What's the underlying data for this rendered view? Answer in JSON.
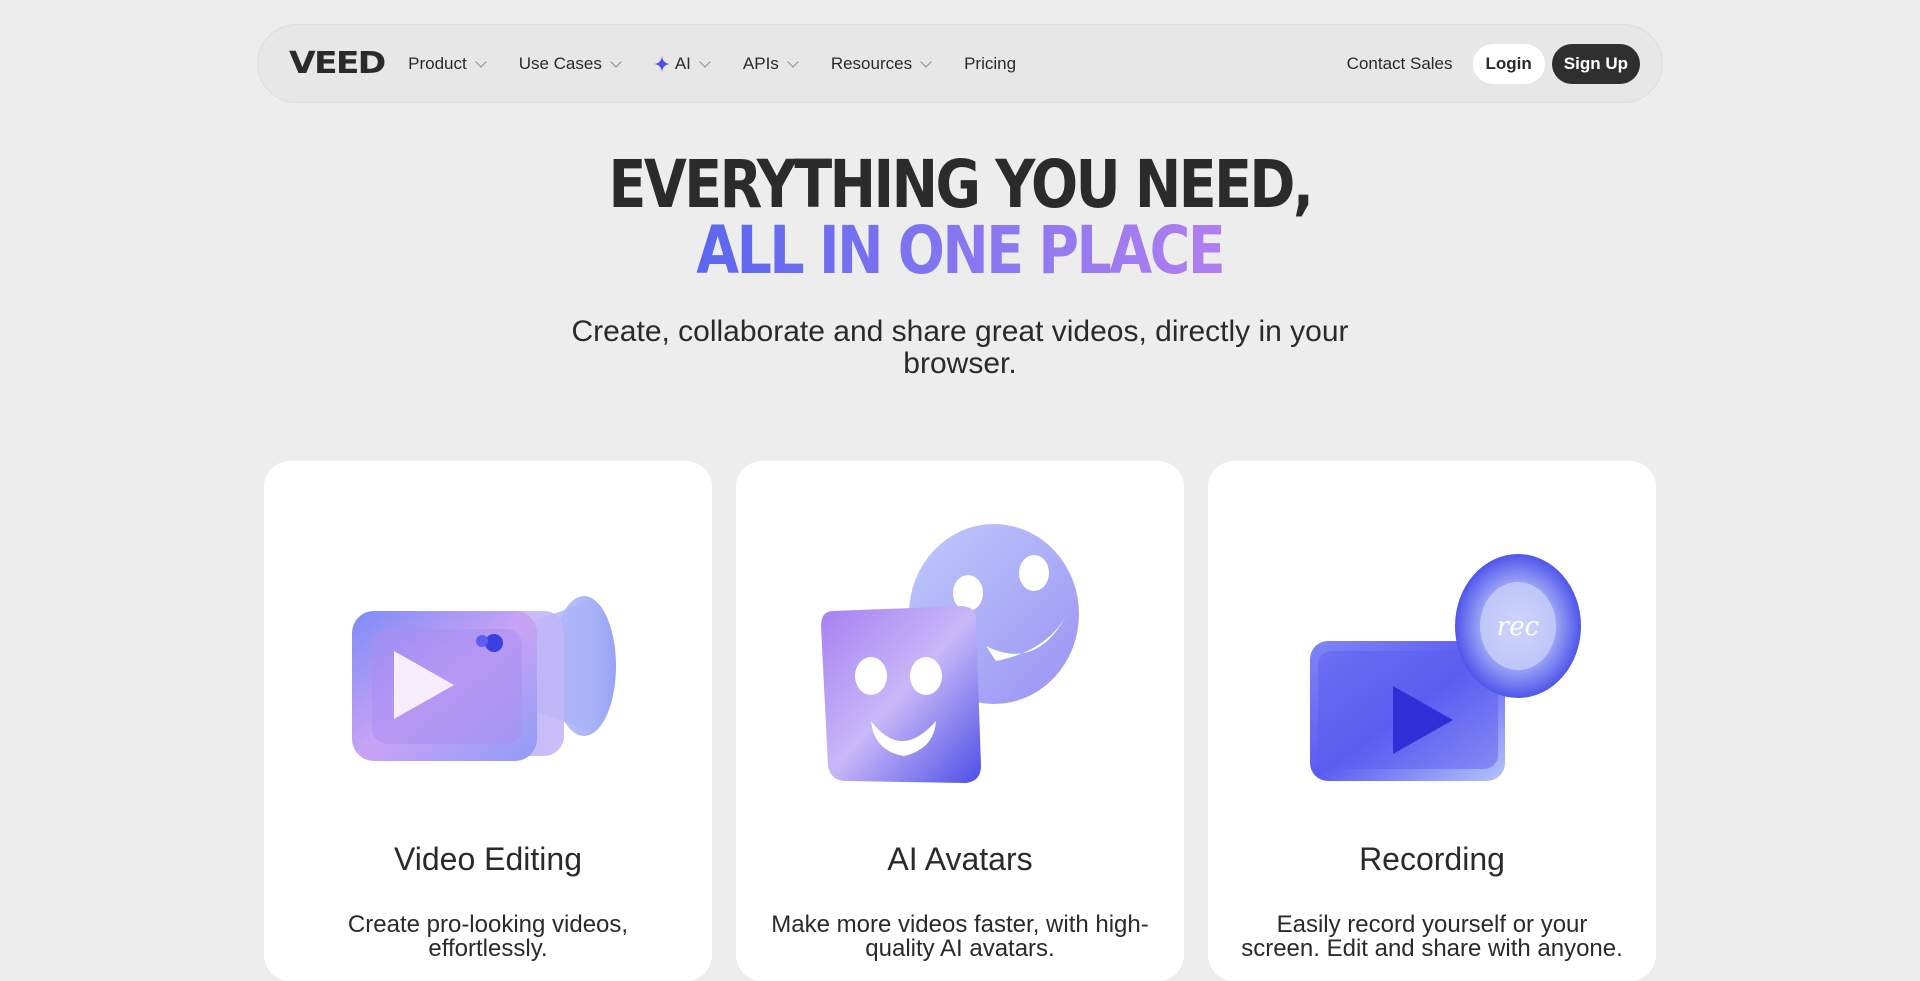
{
  "nav": {
    "logo": "VEED",
    "menu": [
      {
        "label": "Product",
        "has_chevron": true
      },
      {
        "label": "Use Cases",
        "has_chevron": true
      },
      {
        "label": "AI",
        "has_chevron": true,
        "icon": "sparkle-icon"
      },
      {
        "label": "APIs",
        "has_chevron": true
      },
      {
        "label": "Resources",
        "has_chevron": true
      },
      {
        "label": "Pricing",
        "has_chevron": false
      }
    ],
    "contact_sales": "Contact Sales",
    "login": "Login",
    "signup": "Sign Up"
  },
  "hero": {
    "title_line1": "EVERYTHING YOU NEED,",
    "title_line2": "ALL IN ONE PLACE",
    "subtitle": "Create, collaborate and share great videos, directly in your browser."
  },
  "cards": [
    {
      "title": "Video Editing",
      "description": "Create pro-looking videos, effortlessly.",
      "icon": "video-camera-icon"
    },
    {
      "title": "AI Avatars",
      "description": "Make more videos faster, with high-quality AI avatars.",
      "icon": "avatar-faces-icon"
    },
    {
      "title": "Recording",
      "description": "Easily record yourself or your screen. Edit and share with anyone.",
      "icon": "record-icon"
    }
  ],
  "colors": {
    "background": "#ecedec",
    "accent_gradient_start": "#5b66ee",
    "accent_gradient_end": "#b07ef0",
    "dark": "#2f2f2f"
  }
}
